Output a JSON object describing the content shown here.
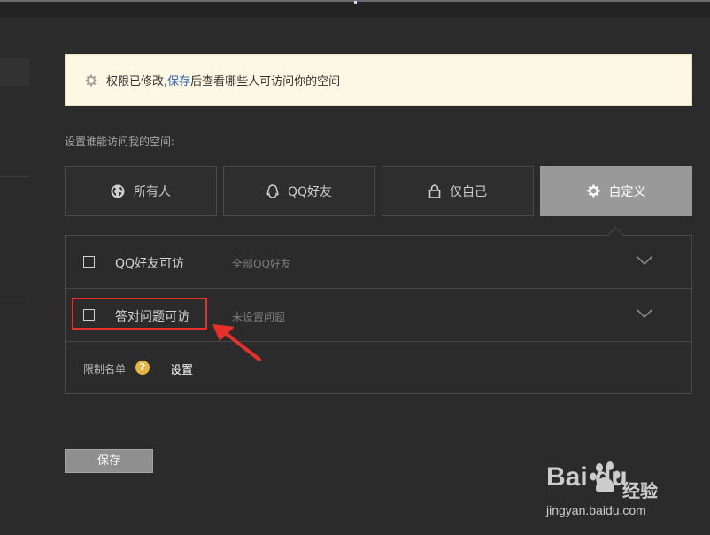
{
  "notice": {
    "before": "权限已修改,",
    "link": "保存",
    "after": "后查看哪些人可访问你的空间"
  },
  "subtitle": "设置谁能访问我的空间:",
  "tabs": [
    {
      "label": "所有人",
      "icon": "globe-icon"
    },
    {
      "label": "QQ好友",
      "icon": "qq-penguin-icon"
    },
    {
      "label": "仅自己",
      "icon": "lock-icon"
    },
    {
      "label": "自定义",
      "icon": "gear-icon",
      "active": true
    }
  ],
  "options": [
    {
      "label": "QQ好友可访",
      "value": "全部QQ好友",
      "checked": false
    },
    {
      "label": "答对问题可访",
      "value": "未设置问题",
      "checked": false
    }
  ],
  "limit": {
    "label": "限制名单",
    "help": "?",
    "link": "设置"
  },
  "save_button": "保存",
  "watermark": {
    "brand": "Bai du",
    "suffix": "经验",
    "url": "jingyan.baidu.com"
  },
  "colors": {
    "notice_bg": "#fcf8e3",
    "active_tab": "#999999",
    "highlight": "#e8302a",
    "link": "#2d64b3"
  }
}
